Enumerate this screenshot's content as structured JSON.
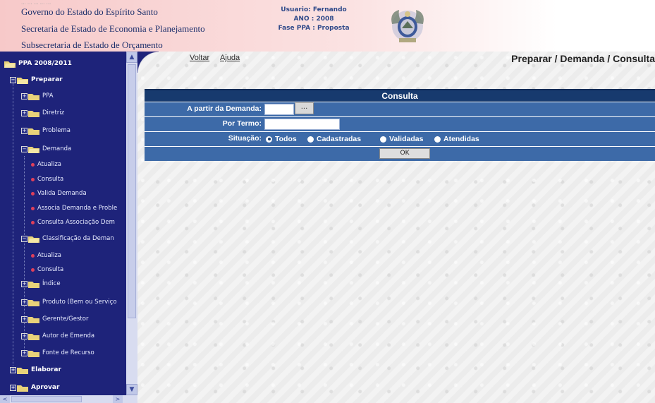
{
  "header": {
    "tiny_text": "... ... ... ... ...",
    "lines": [
      "Governo do Estado do Espírito Santo",
      "Secretaria de Estado de Economia e Planejamento",
      "Subsecretaria de Estado de Orçamento"
    ],
    "user": "Usuario: Fernando",
    "year": "ANO : 2008",
    "phase": "Fase PPA : Proposta"
  },
  "sidebar": {
    "root": "PPA 2008/2011",
    "items": [
      {
        "label": "Preparar"
      },
      {
        "label": "PPA"
      },
      {
        "label": "Diretriz"
      },
      {
        "label": "Problema"
      },
      {
        "label": "Demanda"
      },
      {
        "label": "Atualiza"
      },
      {
        "label": "Consulta"
      },
      {
        "label": "Valida Demanda"
      },
      {
        "label": "Associa Demanda e Proble"
      },
      {
        "label": "Consulta Associação Dem"
      },
      {
        "label": "Classificação da Deman"
      },
      {
        "label": "Atualiza"
      },
      {
        "label": "Consulta"
      },
      {
        "label": "Índice"
      },
      {
        "label": "Produto (Bem ou Serviço"
      },
      {
        "label": "Gerente/Gestor"
      },
      {
        "label": "Autor de Emenda"
      },
      {
        "label": "Fonte de Recurso"
      },
      {
        "label": "Elaborar"
      },
      {
        "label": "Aprovar"
      }
    ],
    "scroll_up": "▲",
    "scroll_down": "▼",
    "scroll_left": "<",
    "scroll_right": ">"
  },
  "main": {
    "link_back": "Voltar",
    "link_help": "Ajuda",
    "page_path": "Preparar / Demanda / Consulta",
    "panel_title": "Consulta",
    "field_demanda_label": "A partir da Demanda:",
    "field_demanda_value": "",
    "lookup_button": "...",
    "field_termo_label": "Por Termo:",
    "field_termo_value": "",
    "situacao_label": "Situação:",
    "situacao_options": [
      "Todos",
      "Cadastradas",
      "Validadas",
      "Atendidas"
    ],
    "situacao_selected": "Todos",
    "ok_button": "OK"
  },
  "colors": {
    "sidebar_bg": "#1e237a",
    "panel_header": "#173a6e",
    "panel_row": "#3d6aa8",
    "header_pink": "#f7c9c9"
  }
}
